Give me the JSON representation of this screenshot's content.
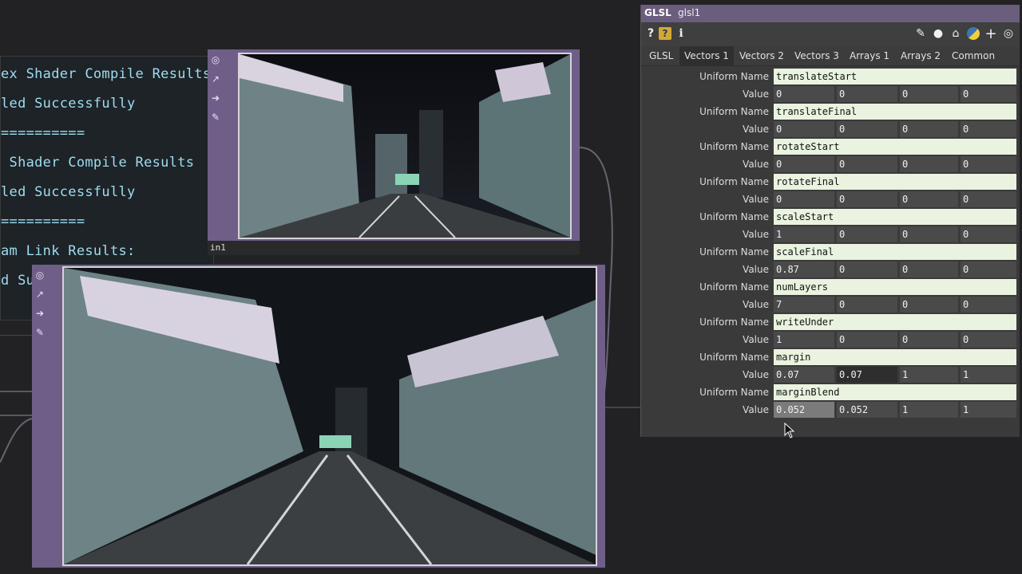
{
  "textdat": {
    "lines": [
      "ex Shader Compile Results",
      "led Successfully",
      "==========",
      " Shader Compile Results",
      "led Successfully",
      "==========",
      "am Link Results:",
      "d Succ"
    ]
  },
  "nodes": {
    "in1_label": "in1"
  },
  "panel": {
    "type_label": "GLSL",
    "node_name": "glsl1",
    "tabs": [
      "GLSL",
      "Vectors 1",
      "Vectors 2",
      "Vectors 3",
      "Arrays 1",
      "Arrays 2",
      "Common"
    ],
    "active_tab": "Vectors 1",
    "uniform_name_label": "Uniform Name",
    "value_label": "Value",
    "uniforms": [
      {
        "name": "translateStart",
        "values": [
          "0",
          "0",
          "0",
          "0"
        ]
      },
      {
        "name": "translateFinal",
        "values": [
          "0",
          "0",
          "0",
          "0"
        ]
      },
      {
        "name": "rotateStart",
        "values": [
          "0",
          "0",
          "0",
          "0"
        ]
      },
      {
        "name": "rotateFinal",
        "values": [
          "0",
          "0",
          "0",
          "0"
        ]
      },
      {
        "name": "scaleStart",
        "values": [
          "1",
          "0",
          "0",
          "0"
        ]
      },
      {
        "name": "scaleFinal",
        "values": [
          "0.87",
          "0",
          "0",
          "0"
        ]
      },
      {
        "name": "numLayers",
        "values": [
          "7",
          "0",
          "0",
          "0"
        ]
      },
      {
        "name": "writeUnder",
        "values": [
          "1",
          "0",
          "0",
          "0"
        ]
      },
      {
        "name": "margin",
        "values": [
          "0.07",
          "0.07",
          "1",
          "1"
        ]
      },
      {
        "name": "marginBlend",
        "values": [
          "0.052",
          "0.052",
          "1",
          "1"
        ]
      }
    ],
    "toolbar_icons": [
      "help-icon",
      "python-help-icon",
      "info-icon",
      "pencil-icon",
      "comment-icon",
      "reset-icon",
      "python-icon",
      "add-icon",
      "target-icon"
    ]
  },
  "colors": {
    "node_purple": "#6f5e88",
    "name_field_bg": "#e9f3df",
    "code_text": "#9fdcf0"
  }
}
